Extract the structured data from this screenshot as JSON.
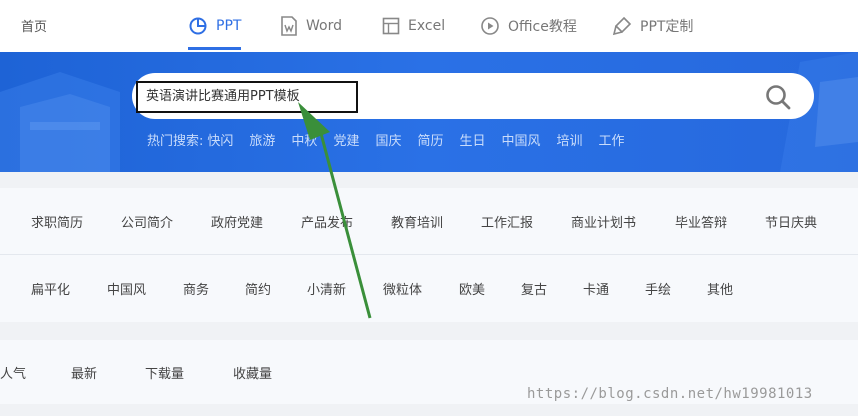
{
  "topnav": {
    "home": "首页",
    "tabs": [
      {
        "label": "PPT",
        "icon": "pie-chart-icon"
      },
      {
        "label": "Word",
        "icon": "word-doc-icon"
      },
      {
        "label": "Excel",
        "icon": "spreadsheet-icon"
      },
      {
        "label": "Office教程",
        "icon": "play-circle-icon"
      },
      {
        "label": "PPT定制",
        "icon": "brush-icon"
      }
    ],
    "active_color": "#2f6fe4"
  },
  "search": {
    "value": "英语演讲比赛通用PPT模板",
    "hot_label": "热门搜索:",
    "hot_terms": [
      "快闪",
      "旅游",
      "中秋",
      "党建",
      "国庆",
      "简历",
      "生日",
      "中国风",
      "培训",
      "工作"
    ]
  },
  "categories": {
    "row1": [
      "求职简历",
      "公司简介",
      "政府党建",
      "产品发布",
      "教育培训",
      "工作汇报",
      "商业计划书",
      "毕业答辩",
      "节日庆典"
    ],
    "row2": [
      "扁平化",
      "中国风",
      "商务",
      "简约",
      "小清新",
      "微粒体",
      "欧美",
      "复古",
      "卡通",
      "手绘",
      "其他"
    ]
  },
  "sort": [
    "人气",
    "最新",
    "下载量",
    "收藏量"
  ],
  "watermark": "https://blog.csdn.net/hw19981013",
  "colors": {
    "hero": "#2a71e6",
    "annotation_arrow": "#3a8f3a"
  }
}
